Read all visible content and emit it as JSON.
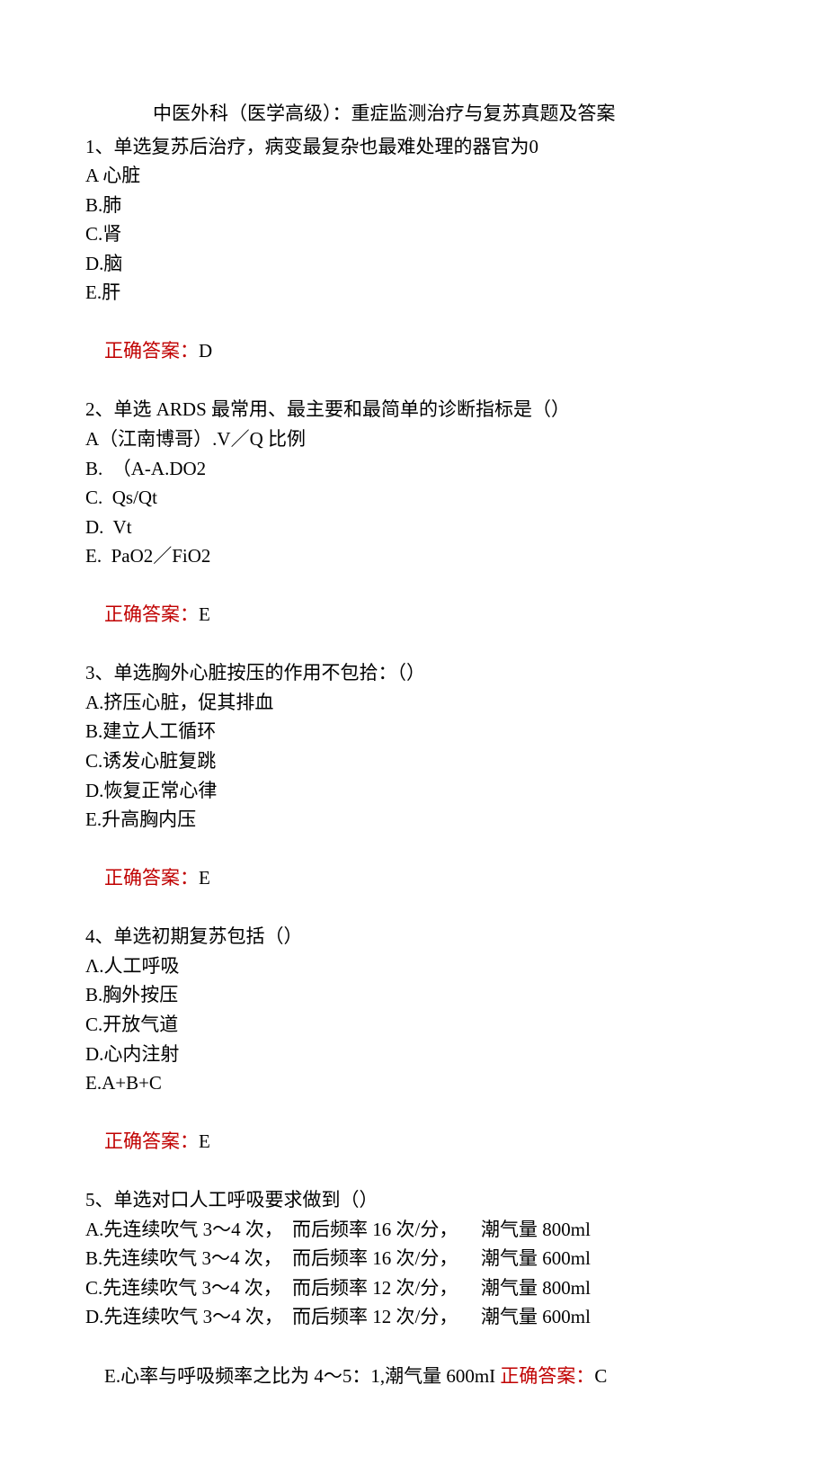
{
  "title": "中医外科（医学高级）：重症监测治疗与复苏真题及答案",
  "q1": {
    "stem": "1、单选复苏后治疗，病变最复杂也最难处理的器官为0",
    "a": "A 心脏",
    "b": "B.肺",
    "c": "C.肾",
    "d": "D.脑",
    "e": "E.肝",
    "ans_label": "正确答案：",
    "ans": "D"
  },
  "q2": {
    "stem": "2、单选 ARDS 最常用、最主要和最简单的诊断指标是（）",
    "a": "A（江南博哥）.V／Q 比例",
    "b": "B.  （A-A.DO2",
    "c": "C.  Qs/Qt",
    "d": "D.  Vt",
    "e": "E.  PaO2／FiO2",
    "ans_label": "正确答案：",
    "ans": "E"
  },
  "q3": {
    "stem": "3、单选胸外心脏按压的作用不包拾：（）",
    "a": "A.挤压心脏，促其排血",
    "b": "B.建立人工循环",
    "c": "C.诱发心脏复跳",
    "d": "D.恢复正常心律",
    "e": "E.升高胸内压",
    "ans_label": "正确答案：",
    "ans": "E"
  },
  "q4": {
    "stem": "4、单选初期复苏包括（）",
    "a": "Λ.人工呼吸",
    "b": "B.胸外按压",
    "c": "C.开放气道",
    "d": "D.心内注射",
    "e": "E.A+B+C",
    "ans_label": "正确答案：",
    "ans": "E"
  },
  "q5": {
    "stem": "5、单选对口人工呼吸要求做到（）",
    "rows": [
      {
        "c1": "A.先连续吹气 3～4 次，",
        "c2": "而后频率 16 次/分，",
        "c3": "潮气量 800ml"
      },
      {
        "c1": "B.先连续吹气 3～4 次，",
        "c2": "而后频率 16 次/分，",
        "c3": "潮气量 600ml"
      },
      {
        "c1": "C.先连续吹气 3～4 次，",
        "c2": "而后频率 12 次/分，",
        "c3": "潮气量 800ml"
      },
      {
        "c1": "D.先连续吹气 3～4 次，",
        "c2": "而后频率 12 次/分，",
        "c3": "潮气量 600ml"
      }
    ],
    "e_pre": "E.心率与呼吸频率之比为 4～5：1,潮气量 600mI ",
    "ans_label": "正确答案：",
    "ans": "C"
  }
}
